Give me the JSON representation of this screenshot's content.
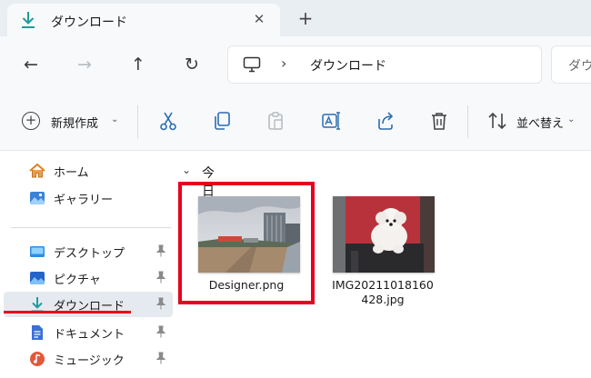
{
  "tab": {
    "title": "ダウンロード",
    "close_glyph": "✕",
    "new_tab_glyph": "+"
  },
  "nav": {
    "back": "←",
    "forward": "→",
    "up": "↑",
    "refresh": "↻"
  },
  "address": {
    "chevron": "›",
    "path": "ダウンロード"
  },
  "search": {
    "placeholder": "ダウ"
  },
  "commands": {
    "new_label": "新規作成",
    "new_chevron": "⌄",
    "sort_label": "並べ替え",
    "sort_chevron": "⌄",
    "icons": [
      "cut-icon",
      "copy-icon",
      "paste-icon",
      "rename-icon",
      "share-icon",
      "delete-icon",
      "sort-icon"
    ]
  },
  "sidebar": {
    "items": [
      {
        "label": "ホーム",
        "icon": "home-icon"
      },
      {
        "label": "ギャラリー",
        "icon": "gallery-icon"
      },
      {
        "label": "デスクトップ",
        "icon": "desktop-icon",
        "pinned": true
      },
      {
        "label": "ピクチャ",
        "icon": "pictures-icon",
        "pinned": true
      },
      {
        "label": "ダウンロード",
        "icon": "download-icon",
        "pinned": true,
        "selected": true
      },
      {
        "label": "ドキュメント",
        "icon": "documents-icon",
        "pinned": true
      },
      {
        "label": "ミュージック",
        "icon": "music-icon",
        "pinned": true
      }
    ]
  },
  "content": {
    "group_chevron": "⌄",
    "group_label": "今日",
    "files": [
      {
        "name": "Designer.png",
        "highlighted": true
      },
      {
        "name_line1": "IMG20211018160",
        "name_line2": "428.jpg"
      }
    ]
  },
  "colors": {
    "accent_download": "#1e9e9a",
    "highlight": "#e8001c",
    "selected_bg": "#e5eaf0",
    "toolbar_bg": "#f7f9fb",
    "tab_bar_bg": "#e9eef3"
  }
}
